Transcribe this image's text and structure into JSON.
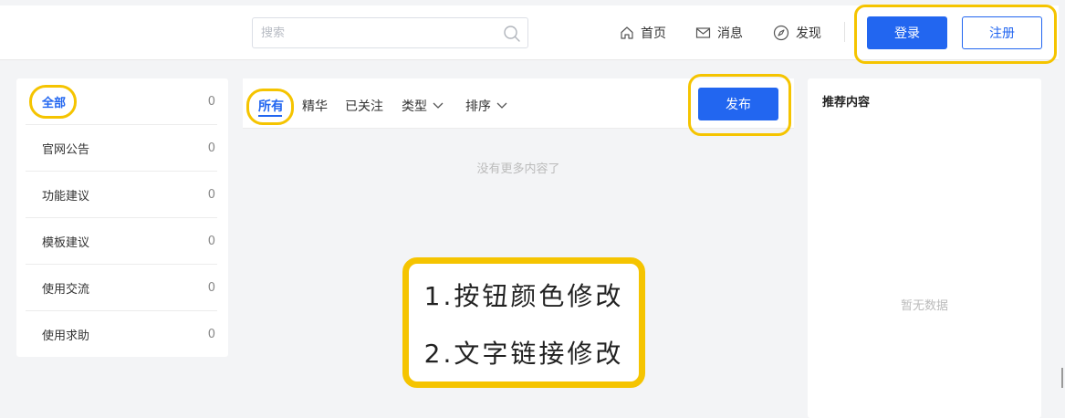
{
  "header": {
    "search_placeholder": "搜索",
    "nav": [
      {
        "label": "首页",
        "icon": "home-icon"
      },
      {
        "label": "消息",
        "icon": "mail-icon"
      },
      {
        "label": "发现",
        "icon": "compass-icon"
      }
    ],
    "login_label": "登录",
    "register_label": "注册"
  },
  "sidebar": {
    "categories": [
      {
        "label": "全部",
        "count": "0",
        "active": true
      },
      {
        "label": "官网公告",
        "count": "0"
      },
      {
        "label": "功能建议",
        "count": "0"
      },
      {
        "label": "模板建议",
        "count": "0"
      },
      {
        "label": "使用交流",
        "count": "0"
      },
      {
        "label": "使用求助",
        "count": "0"
      }
    ]
  },
  "main": {
    "tabs": [
      {
        "label": "所有",
        "active": true
      },
      {
        "label": "精华"
      },
      {
        "label": "已关注"
      },
      {
        "label": "类型",
        "dropdown": true
      },
      {
        "label": "排序",
        "dropdown": true
      }
    ],
    "publish_label": "发布",
    "empty_text": "没有更多内容了"
  },
  "recommend": {
    "title": "推荐内容",
    "empty_text": "暂无数据"
  },
  "annotation": {
    "line1": "1.按钮颜色修改",
    "line2": "2.文字链接修改"
  },
  "colors": {
    "accent": "#2266f0",
    "highlight": "#f5c400"
  }
}
